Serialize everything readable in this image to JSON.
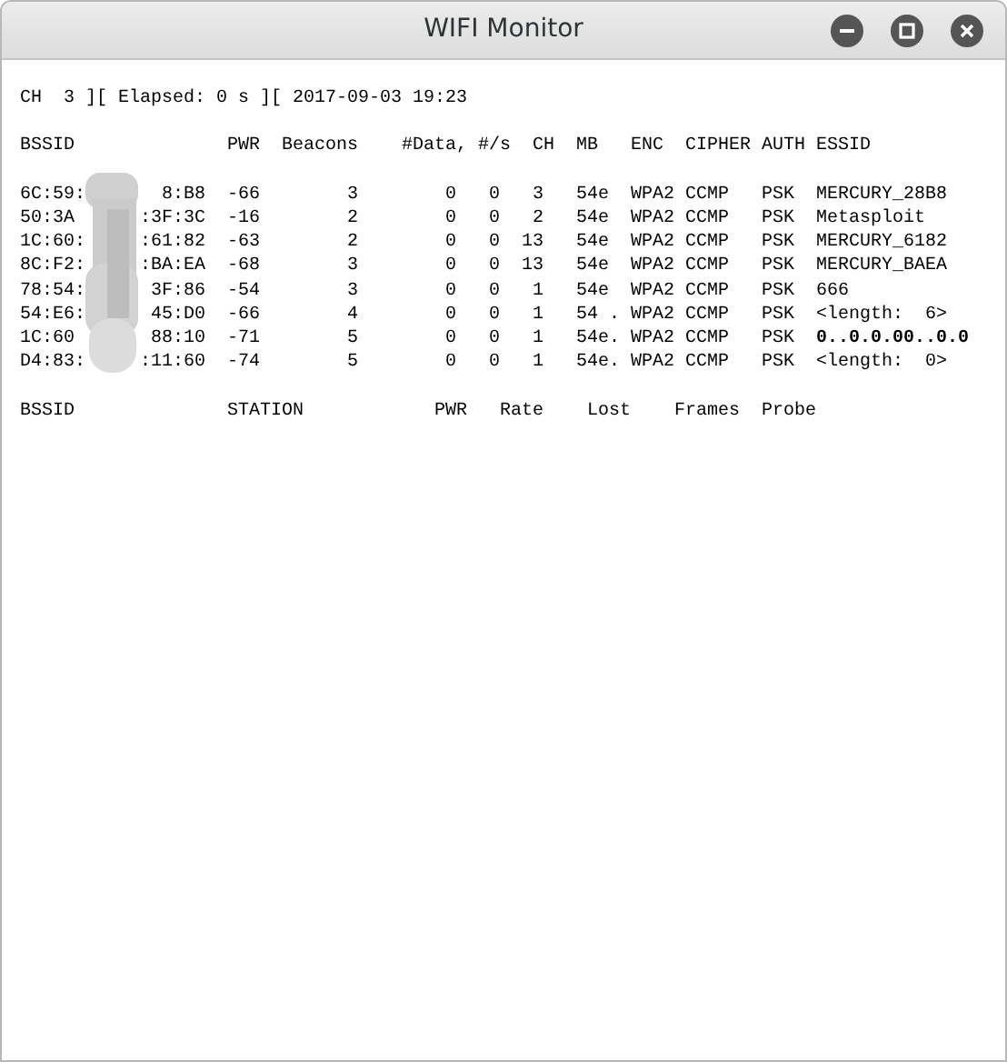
{
  "window": {
    "title": "WIFI Monitor",
    "controls": [
      {
        "kind": "minimize"
      },
      {
        "kind": "maximize"
      },
      {
        "kind": "close"
      }
    ]
  },
  "status_line": "CH  3 ][ Elapsed: 0 s ][ 2017-09-03 19:23",
  "ap_table": {
    "columns": [
      "BSSID",
      "PWR",
      "Beacons",
      "#Data,",
      "#/s",
      "CH",
      "MB",
      "ENC",
      "CIPHER",
      "AUTH",
      "ESSID"
    ],
    "rows": [
      {
        "bssid_start": "6C:59:",
        "bssid_end": "8:B8",
        "pwr": "-66",
        "beacons": "3",
        "data": "0",
        "per_s": "0",
        "ch": "3",
        "mb": "54e",
        "enc": "WPA2",
        "cipher": "CCMP",
        "auth": "PSK",
        "essid": "MERCURY_28B8",
        "essid_bold": false
      },
      {
        "bssid_start": "50:3A",
        "bssid_end": ":3F:3C",
        "pwr": "-16",
        "beacons": "2",
        "data": "0",
        "per_s": "0",
        "ch": "2",
        "mb": "54e",
        "enc": "WPA2",
        "cipher": "CCMP",
        "auth": "PSK",
        "essid": "Metasploit",
        "essid_bold": false
      },
      {
        "bssid_start": "1C:60:",
        "bssid_end": ":61:82",
        "pwr": "-63",
        "beacons": "2",
        "data": "0",
        "per_s": "0",
        "ch": "13",
        "mb": "54e",
        "enc": "WPA2",
        "cipher": "CCMP",
        "auth": "PSK",
        "essid": "MERCURY_6182",
        "essid_bold": false
      },
      {
        "bssid_start": "8C:F2:",
        "bssid_end": ":BA:EA",
        "pwr": "-68",
        "beacons": "3",
        "data": "0",
        "per_s": "0",
        "ch": "13",
        "mb": "54e",
        "enc": "WPA2",
        "cipher": "CCMP",
        "auth": "PSK",
        "essid": "MERCURY_BAEA",
        "essid_bold": false
      },
      {
        "bssid_start": "78:54:",
        "bssid_end": "3F:86",
        "pwr": "-54",
        "beacons": "3",
        "data": "0",
        "per_s": "0",
        "ch": "1",
        "mb": "54e",
        "enc": "WPA2",
        "cipher": "CCMP",
        "auth": "PSK",
        "essid": "666",
        "essid_bold": false
      },
      {
        "bssid_start": "54:E6:",
        "bssid_end": "45:D0",
        "pwr": "-66",
        "beacons": "4",
        "data": "0",
        "per_s": "0",
        "ch": "1",
        "mb": "54 .",
        "enc": "WPA2",
        "cipher": "CCMP",
        "auth": "PSK",
        "essid": "<length:  6>",
        "essid_bold": false
      },
      {
        "bssid_start": "1C:60",
        "bssid_end": "88:10",
        "pwr": "-71",
        "beacons": "5",
        "data": "0",
        "per_s": "0",
        "ch": "1",
        "mb": "54e.",
        "enc": "WPA2",
        "cipher": "CCMP",
        "auth": "PSK",
        "essid": "0..0.0.00..0.0",
        "essid_bold": true
      },
      {
        "bssid_start": "D4:83:",
        "bssid_end": ":11:60",
        "pwr": "-74",
        "beacons": "5",
        "data": "0",
        "per_s": "0",
        "ch": "1",
        "mb": "54e.",
        "enc": "WPA2",
        "cipher": "CCMP",
        "auth": "PSK",
        "essid": "<length:  0>",
        "essid_bold": false
      }
    ]
  },
  "station_table": {
    "columns": [
      "BSSID",
      "STATION",
      "PWR",
      "Rate",
      "Lost",
      "Frames",
      "Probe"
    ]
  }
}
